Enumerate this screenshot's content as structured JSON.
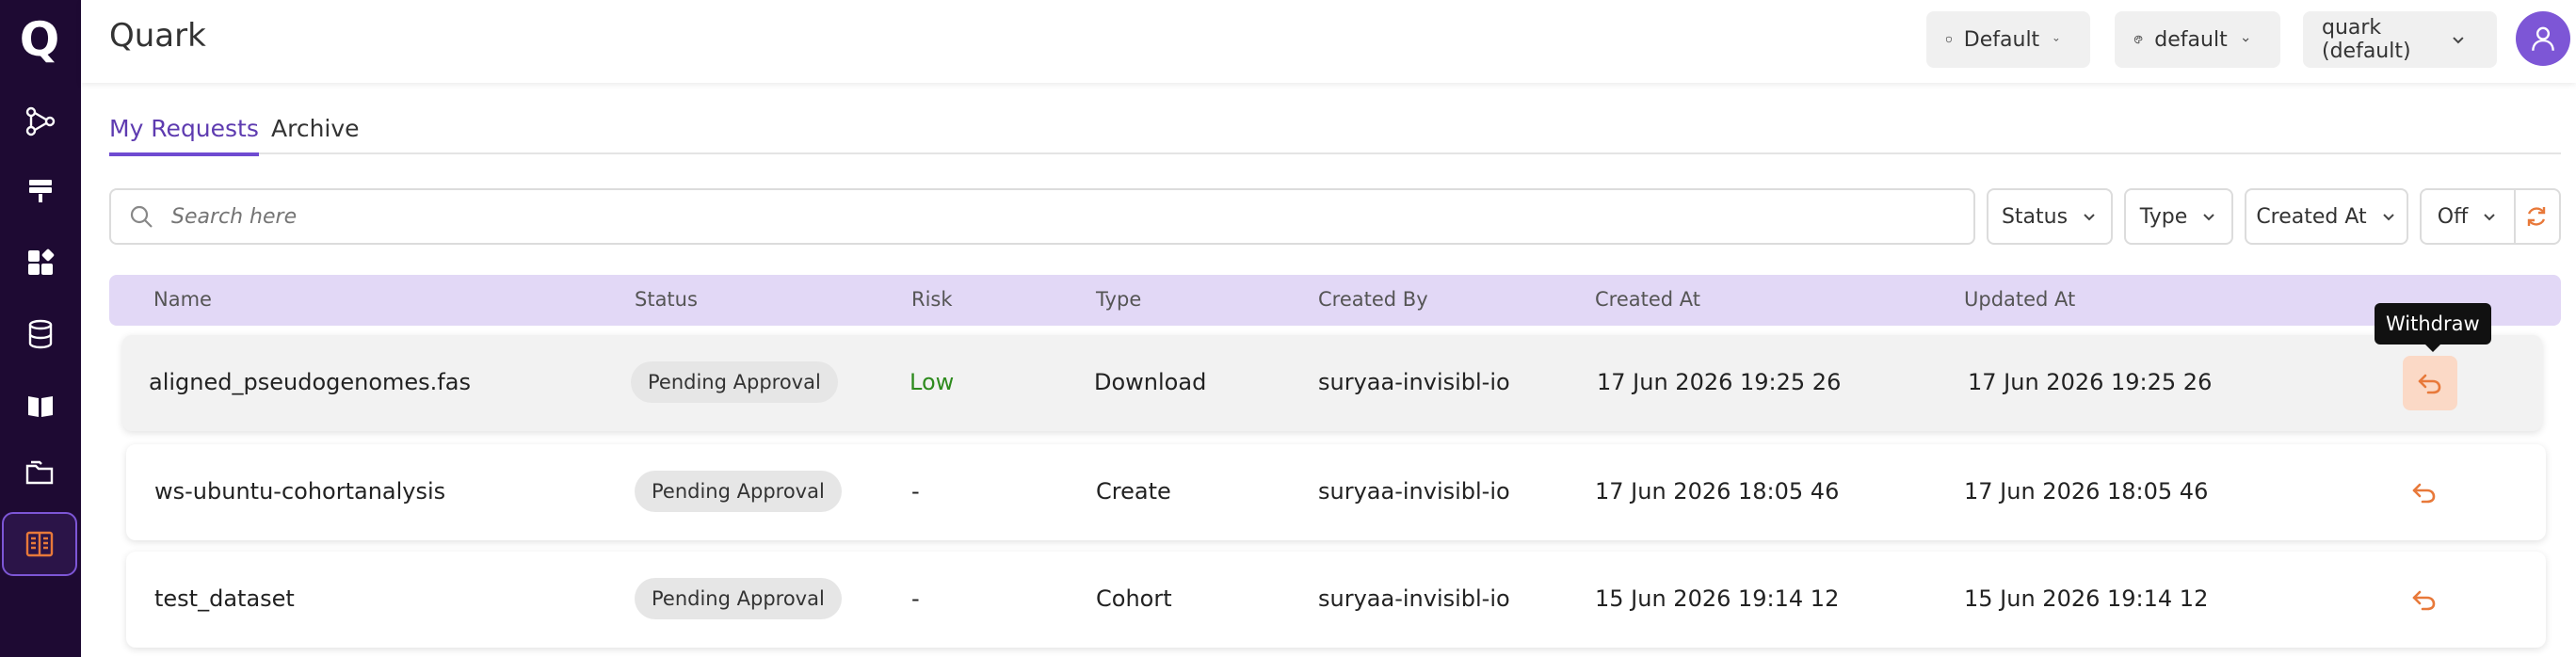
{
  "app": {
    "title": "Quark",
    "logo": "Q"
  },
  "sidebar": {
    "items": [
      {
        "icon": "workflow-icon"
      },
      {
        "icon": "compute-icon"
      },
      {
        "icon": "apps-icon"
      },
      {
        "icon": "database-icon"
      },
      {
        "icon": "book-icon"
      },
      {
        "icon": "folder-icon"
      },
      {
        "icon": "requests-icon",
        "active": true
      }
    ]
  },
  "header": {
    "project": "Default",
    "theme": "default",
    "workspace": "quark (default)"
  },
  "tabs": [
    "My Requests",
    "Archive"
  ],
  "search": {
    "placeholder": "Search here"
  },
  "filters": {
    "status": "Status",
    "type": "Type",
    "created_at": "Created At",
    "auto_refresh": "Off"
  },
  "table": {
    "columns": [
      "Name",
      "Status",
      "Risk",
      "Type",
      "Created By",
      "Created At",
      "Updated At"
    ],
    "rows": [
      {
        "name": "aligned_pseudogenomes.fas",
        "status": "Pending Approval",
        "risk": "Low",
        "type": "Download",
        "created_by": "suryaa-invisibl-io",
        "created_at": "17 Jun 2026 19:25 26",
        "updated_at": "17 Jun 2026 19:25 26"
      },
      {
        "name": "ws-ubuntu-cohortanalysis",
        "status": "Pending Approval",
        "risk": "-",
        "type": "Create",
        "created_by": "suryaa-invisibl-io",
        "created_at": "17 Jun 2026 18:05 46",
        "updated_at": "17 Jun 2026 18:05 46"
      },
      {
        "name": "test_dataset",
        "status": "Pending Approval",
        "risk": "-",
        "type": "Cohort",
        "created_by": "suryaa-invisibl-io",
        "created_at": "15 Jun 2026 19:14 12",
        "updated_at": "15 Jun 2026 19:14 12"
      }
    ]
  },
  "tooltip": "Withdraw",
  "colors": {
    "sidebar": "#1e0a33",
    "accent": "#6f4bd1",
    "action": "#e8793a",
    "risk_low": "#2e8b1e"
  }
}
